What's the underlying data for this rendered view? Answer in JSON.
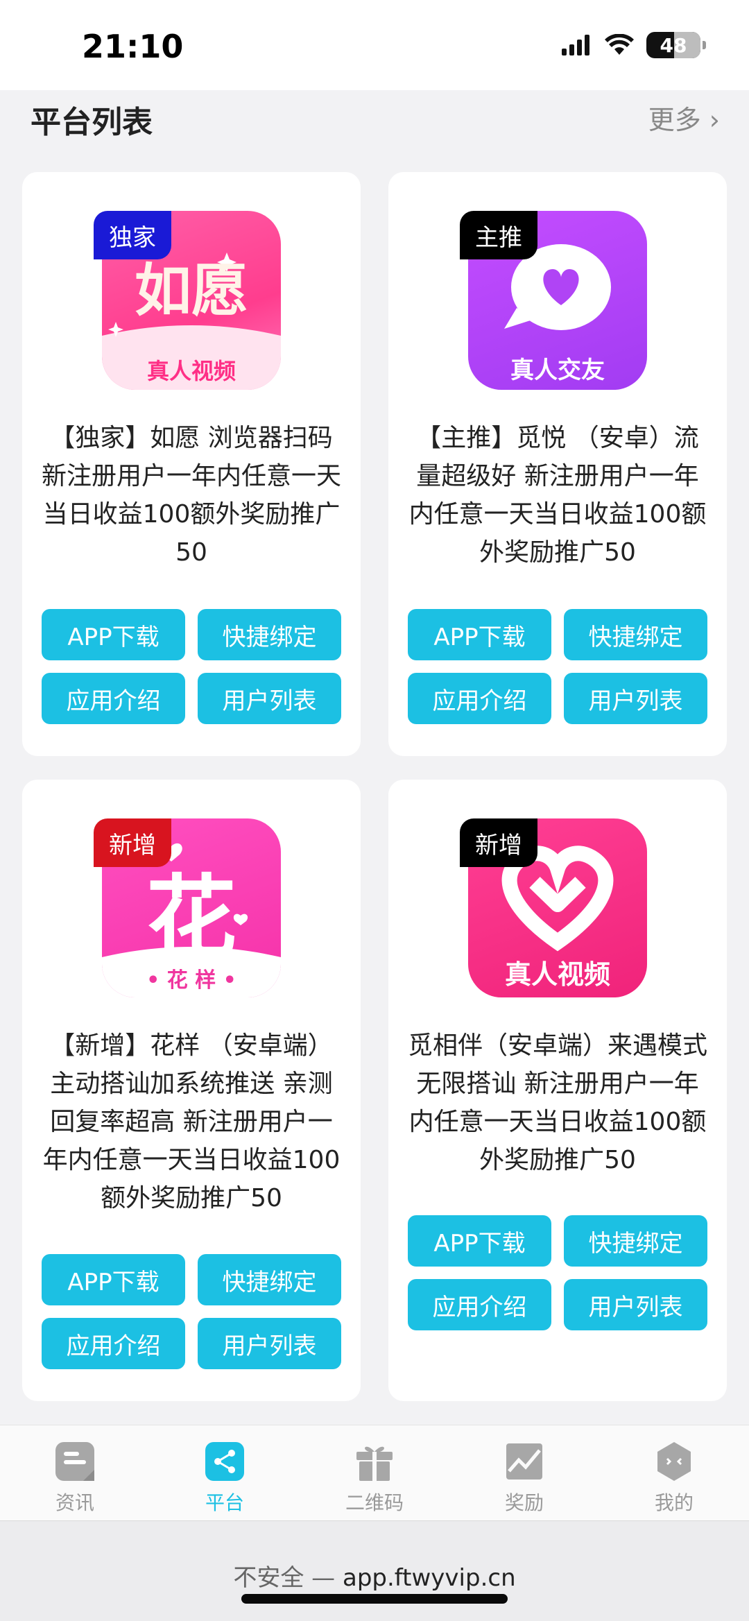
{
  "status": {
    "time": "21:10",
    "battery": "48"
  },
  "section": {
    "title": "平台列表",
    "more": "更多"
  },
  "cards": [
    {
      "tag": "独家",
      "tag_color": "#1a1ad6",
      "icon_text": "如愿",
      "icon_sub": "真人视频",
      "desc": "【独家】如愿 浏览器扫码新注册用户一年内任意一天当日收益100额外奖励推广50",
      "buttons": [
        "APP下载",
        "快捷绑定",
        "应用介绍",
        "用户列表"
      ]
    },
    {
      "tag": "主推",
      "tag_color": "#000000",
      "icon_text": "",
      "icon_sub": "真人交友",
      "desc": "【主推】觅悦 （安卓）流量超级好 新注册用户一年内任意一天当日收益100额外奖励推广50",
      "buttons": [
        "APP下载",
        "快捷绑定",
        "应用介绍",
        "用户列表"
      ]
    },
    {
      "tag": "新增",
      "tag_color": "#d8141f",
      "icon_text": "花",
      "icon_sub": "• 花 样 •",
      "desc": "【新增】花样 （安卓端）主动搭讪加系统推送 亲测回复率超高 新注册用户一年内任意一天当日收益100额外奖励推广50",
      "buttons": [
        "APP下载",
        "快捷绑定",
        "应用介绍",
        "用户列表"
      ]
    },
    {
      "tag": "新增",
      "tag_color": "#000000",
      "icon_text": "",
      "icon_sub": "真人视频",
      "desc": "觅相伴（安卓端）来遇模式无限搭讪 新注册用户一年内任意一天当日收益100额外奖励推广50",
      "buttons": [
        "APP下载",
        "快捷绑定",
        "应用介绍",
        "用户列表"
      ]
    }
  ],
  "tabs": [
    {
      "label": "资讯",
      "icon": "news-icon"
    },
    {
      "label": "平台",
      "icon": "share-icon"
    },
    {
      "label": "二维码",
      "icon": "gift-icon"
    },
    {
      "label": "奖励",
      "icon": "chart-icon"
    },
    {
      "label": "我的",
      "icon": "profile-icon"
    }
  ],
  "url_bar": {
    "insecure": "不安全 —",
    "domain": "app.ftwyvip.cn"
  },
  "colors": {
    "accent": "#1cc0e3",
    "background": "#f2f2f4"
  }
}
